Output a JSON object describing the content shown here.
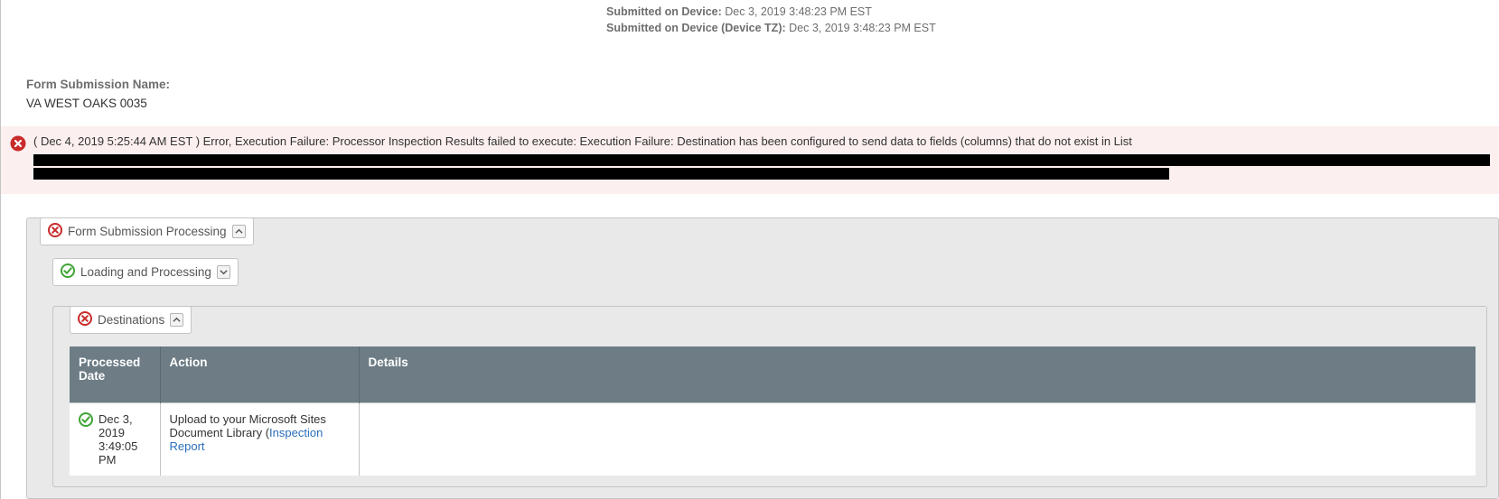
{
  "meta": {
    "submitted_label": "Submitted on Device:",
    "submitted_value": "Dec 3, 2019 3:48:23 PM EST",
    "submitted_tz_label": "Submitted on Device (Device TZ):",
    "submitted_tz_value": "Dec 3, 2019 3:48:23 PM EST"
  },
  "form_name": {
    "label": "Form Submission Name:",
    "value": "VA WEST OAKS 0035"
  },
  "error": {
    "text": "( Dec 4, 2019 5:25:44 AM EST ) Error, Execution Failure: Processor Inspection Results failed to execute: Execution Failure: Destination has been configured to send data to fields (columns) that do not exist in List"
  },
  "panels": {
    "main": {
      "title": "Form Submission Processing"
    },
    "loading": {
      "title": "Loading and Processing"
    },
    "destinations": {
      "title": "Destinations"
    }
  },
  "dest_table": {
    "headers": {
      "processed": "Processed Date",
      "action": "Action",
      "details": "Details"
    },
    "rows": [
      {
        "date": "Dec 3, 2019 3:49:05 PM",
        "action_prefix": "Upload to your Microsoft Sites Document Library (",
        "action_link": "Inspection Report",
        "details": ""
      }
    ]
  }
}
